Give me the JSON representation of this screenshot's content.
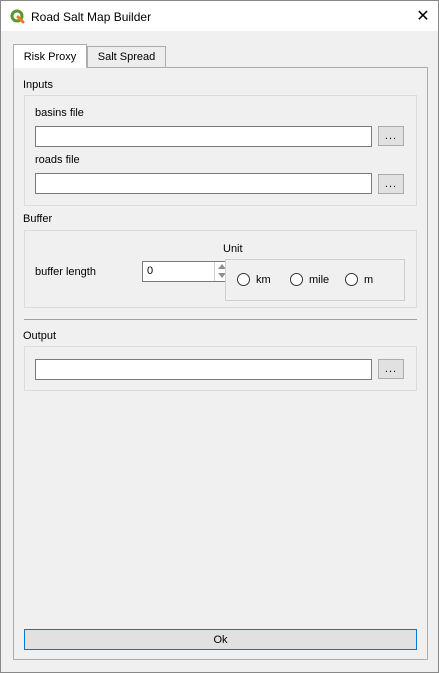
{
  "window": {
    "title": "Road Salt Map Builder"
  },
  "tabs": [
    {
      "label": "Risk Proxy",
      "active": true
    },
    {
      "label": "Salt Spread",
      "active": false
    }
  ],
  "inputs": {
    "heading": "Inputs",
    "basins_label": "basins file",
    "basins_value": "",
    "roads_label": "roads file",
    "roads_value": "",
    "browse_label": "..."
  },
  "buffer": {
    "heading": "Buffer",
    "length_label": "buffer length",
    "length_value": "0",
    "unit_heading": "Unit",
    "units": [
      {
        "label": "km",
        "checked": false
      },
      {
        "label": "mile",
        "checked": false
      },
      {
        "label": "m",
        "checked": false
      }
    ]
  },
  "output": {
    "heading": "Output",
    "value": "",
    "browse_label": "..."
  },
  "ok_label": "Ok",
  "colors": {
    "accent": "#0078d7",
    "qgis_green": "#589632",
    "qgis_yellow": "#ee7913"
  }
}
